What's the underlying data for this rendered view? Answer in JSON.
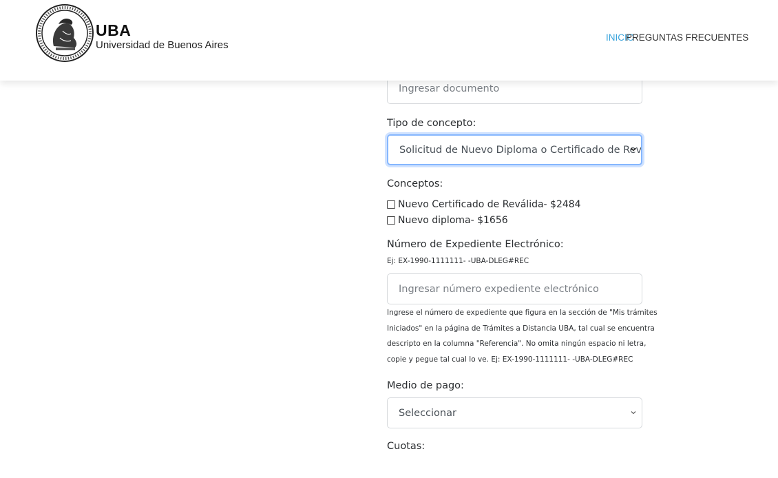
{
  "header": {
    "logo_title": "UBA",
    "logo_subtitle": "Universidad de Buenos Aires",
    "seal_icon": "university-seal-icon",
    "nav": [
      {
        "label": "INICIO",
        "active": true
      },
      {
        "label": "PREGUNTAS FRECUENTES",
        "active": false
      }
    ]
  },
  "form": {
    "documento": {
      "value": "",
      "placeholder": "Ingresar documento"
    },
    "tipo_concepto": {
      "label": "Tipo de concepto:",
      "selected": "Solicitud de Nuevo Diploma o Certificado de Reválida"
    },
    "conceptos": {
      "label": "Conceptos:",
      "items": [
        {
          "label": "Nuevo Certificado de Reválida- $2484",
          "checked": false
        },
        {
          "label": "Nuevo diploma- $1656",
          "checked": false
        }
      ]
    },
    "expediente": {
      "label": "Número de Expediente Electrónico:",
      "example": "Ej: EX-1990-1111111- -UBA-DLEG#REC",
      "value": "",
      "placeholder": "Ingresar número expediente electrónico",
      "help_lines": [
        "Ingrese el número de expediente que figura en la sección de \"Mis trámites",
        "Iniciados\" en la página de Trámites a Distancia UBA, tal cual se encuentra",
        "descripto en la columna \"Referencia\". No omita ningún espacio ni letra,",
        "copie y pegue tal cual lo ve. Ej: EX-1990-1111111- -UBA-DLEG#REC"
      ]
    },
    "medio_pago": {
      "label": "Medio de pago:",
      "selected": "Seleccionar"
    },
    "cuotas": {
      "label": "Cuotas:"
    }
  },
  "colors": {
    "nav_active": "#3ba4dc",
    "focus_border": "#86b7fe",
    "input_border": "#d6d9dc"
  }
}
